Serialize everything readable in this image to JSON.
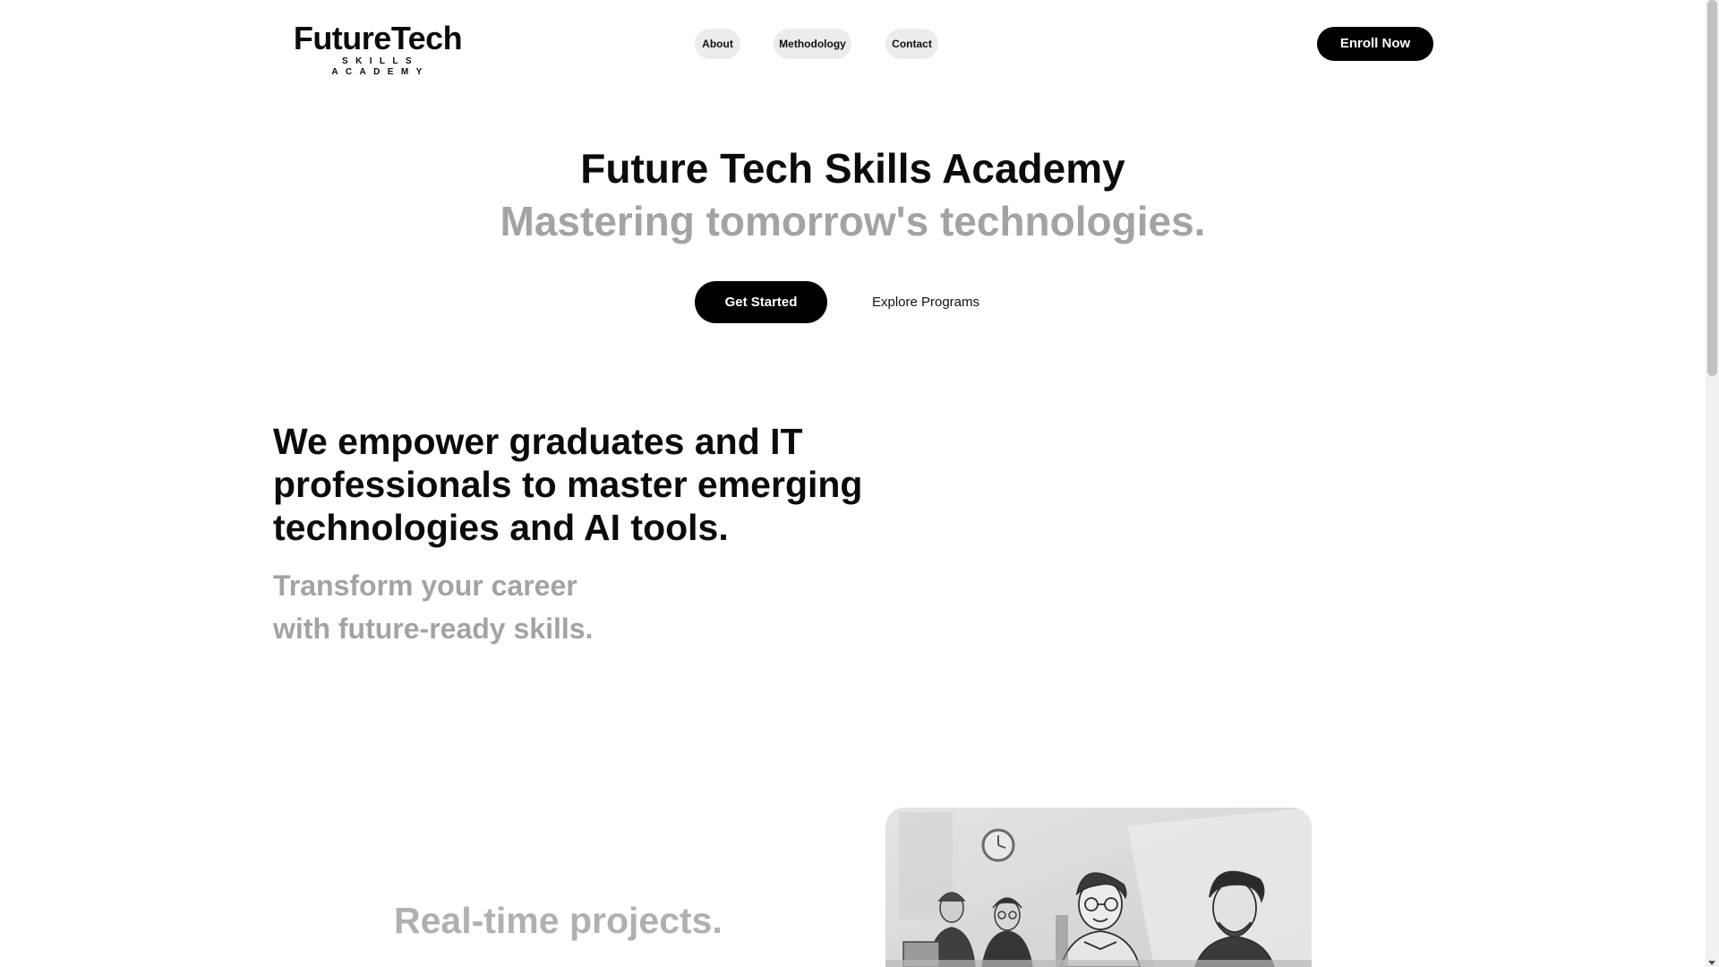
{
  "header": {
    "logo": {
      "title": "FutureTech",
      "subtitle": "SKILLS ACADEMY"
    },
    "nav": [
      {
        "label": "About"
      },
      {
        "label": "Methodology"
      },
      {
        "label": "Contact"
      }
    ],
    "enroll_label": "Enroll Now"
  },
  "hero": {
    "title": "Future Tech Skills Academy",
    "subtitle": "Mastering tomorrow's technologies.",
    "primary_cta": "Get Started",
    "secondary_cta": "Explore Programs"
  },
  "mission": {
    "headline": "We empower graduates and IT professionals to master emerging technologies and AI tools.",
    "tagline_line1": "Transform your career",
    "tagline_line2": "with future-ready skills."
  },
  "projects": {
    "heading": "Real-time projects."
  },
  "colors": {
    "primary": "#000000",
    "muted_text": "#a3a3a3",
    "nav_pill_bg": "#ececec",
    "background": "#ffffff"
  }
}
